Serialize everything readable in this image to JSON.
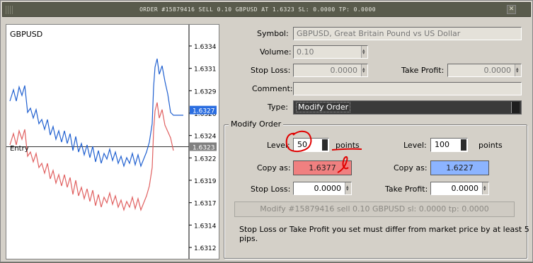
{
  "window": {
    "title": "ORDER #15879416 SELL 0.10 GBPUSD AT 1.6323 SL: 0.0000 TP: 0.0000"
  },
  "chart": {
    "symbol": "GBPUSD",
    "entry_label": "Entry",
    "price_ticks": [
      "1.6334",
      "1.6331",
      "1.6329",
      "1.6326",
      "1.6324",
      "1.6322",
      "1.6319",
      "1.6317",
      "1.6314",
      "1.6312"
    ],
    "current_bid": "1.6327",
    "entry_price": "1.6323",
    "colors": {
      "bid": "#2060d0",
      "ask": "#e06060",
      "bid_tag": "#2a6de0",
      "entry_tag": "#808080"
    }
  },
  "form": {
    "symbol_label": "Symbol:",
    "symbol_value": "GBPUSD, Great Britain Pound vs US Dollar",
    "volume_label": "Volume:",
    "volume_value": "0.10",
    "stoploss_label": "Stop Loss:",
    "stoploss_value": "0.0000",
    "takeprofit_label": "Take Profit:",
    "takeprofit_value": "0.0000",
    "comment_label": "Comment:",
    "comment_value": "",
    "type_label": "Type:",
    "type_value": "Modify Order"
  },
  "modify": {
    "legend": "Modify Order",
    "level_label_left": "Level:",
    "level_left_value": "50",
    "points_left": "points",
    "level_label_right": "Level:",
    "level_right_value": "100",
    "points_right": "points",
    "copyas_label_left": "Copy as:",
    "copyas_left_value": "1.6377",
    "copyas_label_right": "Copy as:",
    "copyas_right_value": "1.6227",
    "sl_label": "Stop Loss:",
    "sl_value": "0.0000",
    "tp_label": "Take Profit:",
    "tp_value": "0.0000",
    "modify_button": "Modify #15879416 sell 0.10 GBPUSD sl: 0.0000 tp: 0.0000",
    "hint": "Stop Loss or Take Profit you set must differ from market price by at least 5 pips.",
    "colors": {
      "copy_left": "#f08080",
      "copy_right": "#8cb4ff",
      "annotation": "#e00000"
    }
  }
}
